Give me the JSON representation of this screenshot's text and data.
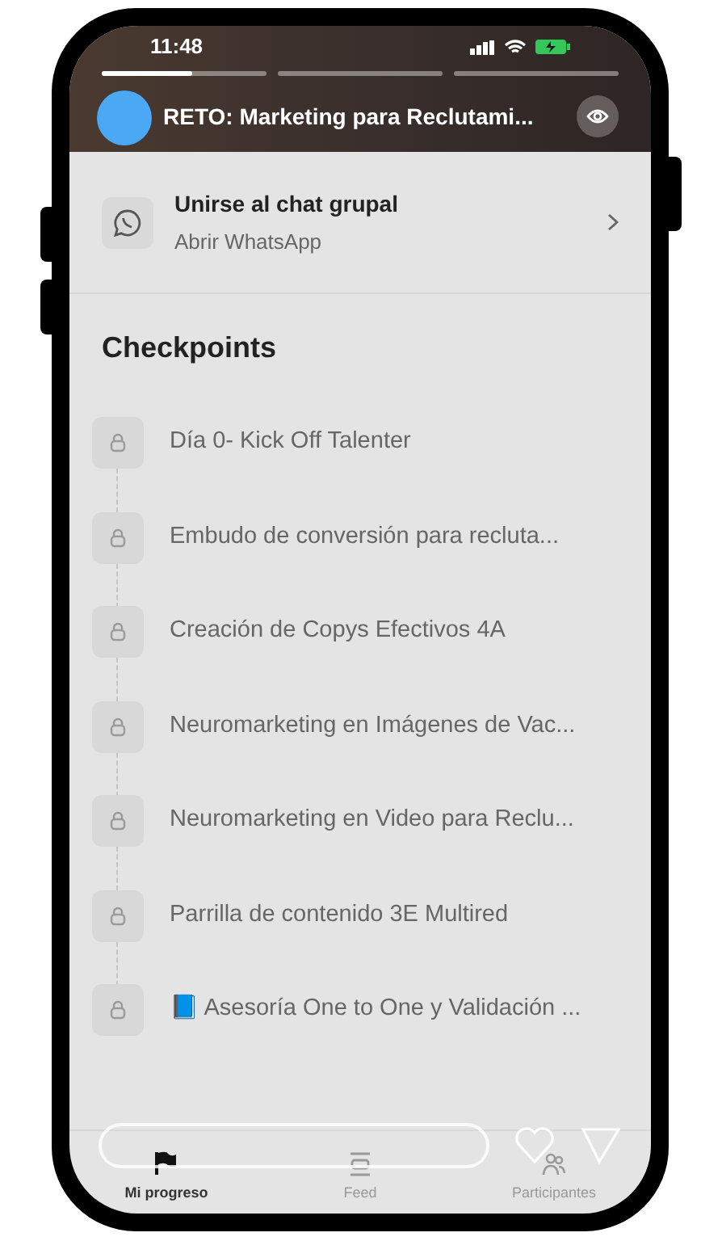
{
  "status_bar": {
    "time": "11:48"
  },
  "story_segments": [
    {
      "level": 0.55
    },
    {
      "level": 0
    },
    {
      "level": 0
    }
  ],
  "header": {
    "title": "RETO: Marketing para Reclutami..."
  },
  "group_chat": {
    "title": "Unirse al chat grupal",
    "subtitle": "Abrir WhatsApp"
  },
  "checkpoints": {
    "heading": "Checkpoints",
    "items": [
      {
        "label": "Día 0- Kick Off Talenter",
        "locked": true
      },
      {
        "label": "Embudo de conversión para recluta...",
        "locked": true
      },
      {
        "label": "Creación de Copys Efectivos 4A",
        "locked": true
      },
      {
        "label": "Neuromarketing en Imágenes de Vac...",
        "locked": true
      },
      {
        "label": "Neuromarketing en Video para Reclu...",
        "locked": true
      },
      {
        "label": "Parrilla de contenido 3E Multired",
        "locked": true
      },
      {
        "label": "📘 Asesoría One to One y Validación ...",
        "locked": true
      }
    ]
  },
  "bottom_nav": [
    {
      "label": "Mi progreso",
      "kind": "flag",
      "selected": true
    },
    {
      "label": "Feed",
      "kind": "feed",
      "selected": false
    },
    {
      "label": "Participantes",
      "kind": "people",
      "selected": false
    }
  ]
}
